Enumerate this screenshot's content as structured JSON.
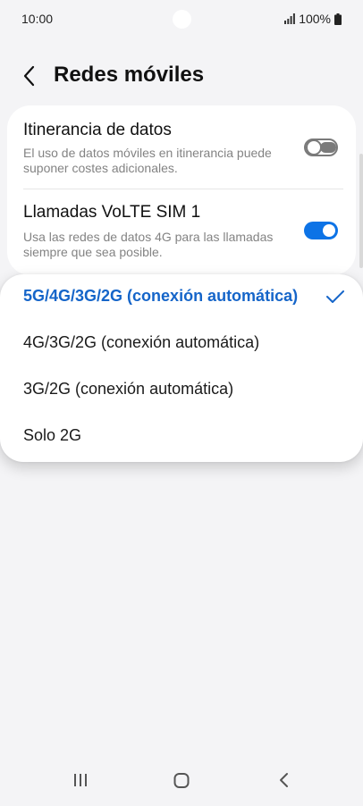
{
  "status": {
    "time": "10:00",
    "battery": "100%",
    "icons": [
      "signal-icon",
      "battery-icon"
    ]
  },
  "header": {
    "title": "Redes móviles",
    "back_icon": "chevron-left-icon"
  },
  "settings": [
    {
      "title": "Itinerancia de datos",
      "description": "El uso de datos móviles en itinerancia puede suponer costes adicionales.",
      "enabled": false
    },
    {
      "title": "Llamadas VoLTE SIM 1",
      "description": "Usa las redes de datos 4G para las llamadas siempre que sea posible.",
      "enabled": true
    }
  ],
  "network_mode": {
    "options": [
      {
        "label": "5G/4G/3G/2G (conexión automática)",
        "selected": true
      },
      {
        "label": "4G/3G/2G (conexión automática)",
        "selected": false
      },
      {
        "label": "3G/2G (conexión automática)",
        "selected": false
      },
      {
        "label": "Solo 2G",
        "selected": false
      }
    ],
    "check_icon": "check-icon"
  },
  "nav": {
    "icons": [
      "recents-icon",
      "home-icon",
      "back-icon"
    ]
  },
  "colors": {
    "accent": "#0d73e6",
    "selected_text": "#1565c9",
    "background": "#f4f4f6",
    "toggle_off": "#7a7a7a"
  }
}
